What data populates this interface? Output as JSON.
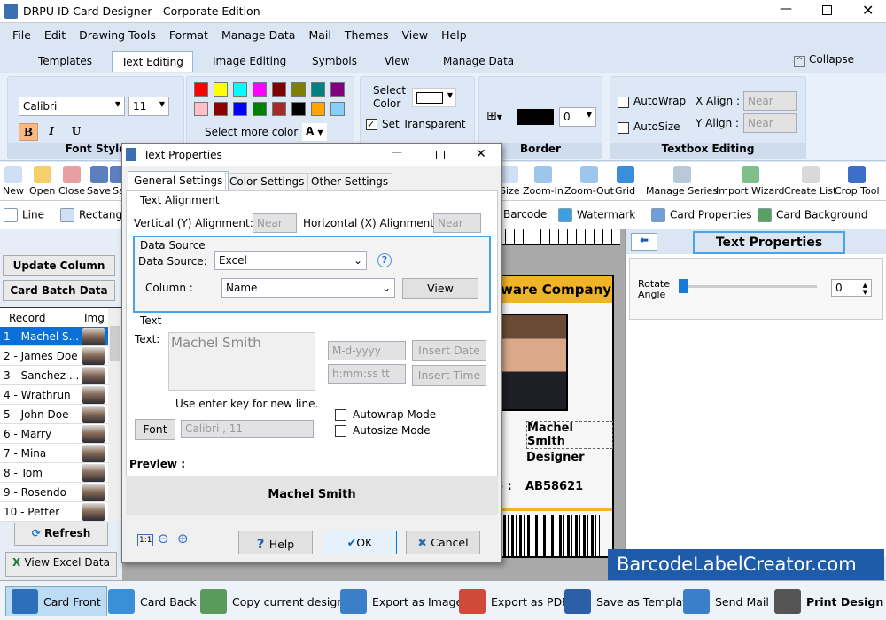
{
  "window": {
    "title": "DRPU ID Card Designer - Corporate Edition"
  },
  "menu": [
    "File",
    "Edit",
    "Drawing Tools",
    "Format",
    "Manage Data",
    "Mail",
    "Themes",
    "View",
    "Help"
  ],
  "tabs": [
    "Templates",
    "Text Editing",
    "Image Editing",
    "Symbols",
    "View",
    "Manage Data"
  ],
  "collapse": "Collapse",
  "ribbon": {
    "font_style": {
      "font": "Calibri",
      "size": "11",
      "bold": "B",
      "italic": "I",
      "underline": "U",
      "label": "Font Style"
    },
    "colors": [
      "#ff0000",
      "#ffff00",
      "#00ffff",
      "#ff00ff",
      "#800000",
      "#808000",
      "#008080",
      "#800080",
      "#ffc0cb",
      "#8b0000",
      "#0000ff",
      "#008000",
      "#a52a2a",
      "#000000",
      "#ffa500",
      "#87cefa"
    ],
    "select_more_color": "Select more color",
    "font_color_glyph": "A",
    "select_color": "Select\nColor",
    "set_transparent": "Set Transparent",
    "set_transparent_checked": true,
    "border": {
      "label": "Border",
      "width": "0"
    },
    "textbox": {
      "autowrap": "AutoWrap",
      "autosize": "AutoSize",
      "x_align": "X Align :",
      "y_align": "Y Align :",
      "x_value": "Near",
      "y_value": "Near",
      "label": "Textbox Editing"
    }
  },
  "toolbar": [
    "New",
    "Open",
    "Close",
    "Save",
    "Sa",
    "Size",
    "Zoom-In",
    "Zoom-Out",
    "Grid",
    "Manage Series",
    "Import Wizard",
    "Create List",
    "Crop Tool"
  ],
  "toolbar2": [
    "Line",
    "Rectangl",
    "Barcode",
    "Watermark",
    "Card Properties",
    "Card Background"
  ],
  "left": {
    "update_column": "Update Column",
    "card_batch": "Card Batch Data",
    "col_record": "Record",
    "col_img": "Img",
    "records": [
      "1 - Machel S...",
      "2 - James Doe",
      "3 - Sanchez ...",
      "4 - Wrathrun",
      "5 - John Doe",
      "6 - Marry",
      "7 - Mina",
      "8 - Tom",
      "9 - Rosendo",
      "10 - Petter"
    ],
    "refresh": "Refresh",
    "view_excel": "View Excel Data"
  },
  "dialog": {
    "title": "Text Properties",
    "tabs": [
      "General Settings",
      "Color Settings",
      "Other Settings"
    ],
    "text_alignment": "Text Alignment",
    "vertical": "Vertical (Y) Alignment:",
    "vertical_value": "Near",
    "horizontal": "Horizontal (X) Alignment:",
    "horizontal_value": "Near",
    "data_source_group": "Data Source",
    "data_source_label": "Data Source:",
    "data_source_value": "Excel",
    "help_glyph": "?",
    "column_label": "Column :",
    "column_value": "Name",
    "view": "View",
    "text_group": "Text",
    "text_label": "Text:",
    "text_value": "Machel Smith",
    "date_format": "M-d-yyyy",
    "time_format": "h:mm:ss tt",
    "insert_date": "Insert Date",
    "insert_time": "Insert Time",
    "hint": "Use enter key for new line.",
    "autowrap": "Autowrap Mode",
    "autosize": "Autosize Mode",
    "font_btn": "Font",
    "font_value": "Calibri , 11",
    "preview_label": "Preview :",
    "preview_text": "Machel Smith",
    "zoom_reset": "1:1",
    "help": "Help",
    "ok": "OK",
    "cancel": "Cancel"
  },
  "card": {
    "company": "ware Company",
    "name": "Machel Smith",
    "designation": "Designer",
    "id_label": "o :",
    "id_value": "AB58621",
    "accent": "#f0b428"
  },
  "right": {
    "title": "Text Properties",
    "rotate_label": "Rotate\nAngle",
    "rotate_value": "0"
  },
  "watermark": "BarcodeLabelCreator.com",
  "bottom": [
    "Card Front",
    "Card Back",
    "Copy current design",
    "Export as Image",
    "Export as PDF",
    "Save as Template",
    "Send Mail",
    "Print Design"
  ]
}
